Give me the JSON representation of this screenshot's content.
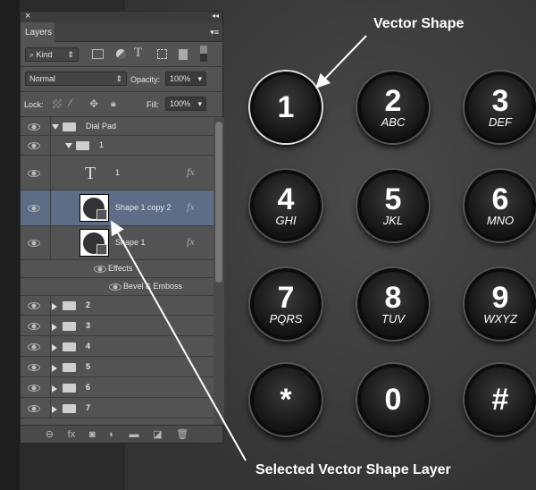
{
  "panel": {
    "close": "×",
    "collapse": "◂◂",
    "tab": "Layers",
    "menu": "▾≡",
    "filter": "Kind",
    "blend_mode": "Normal",
    "opacity_label": "Opacity:",
    "opacity": "100%",
    "lock_label": "Lock:",
    "fill_label": "Fill:",
    "fill": "100%"
  },
  "layers": [
    {
      "name": "Dial Pad",
      "type": "group",
      "expanded": true
    },
    {
      "name": "1",
      "type": "group",
      "expanded": true
    },
    {
      "name": "1",
      "type": "text",
      "fx": "fx"
    },
    {
      "name": "Shape 1 copy 2",
      "type": "shape",
      "fx": "fx",
      "selected": true
    },
    {
      "name": "Shape 1",
      "type": "shape",
      "fx": "fx"
    },
    {
      "name": "Effects",
      "type": "effects"
    },
    {
      "name": "Bevel & Emboss",
      "type": "effect"
    },
    {
      "name": "2",
      "type": "group"
    },
    {
      "name": "3",
      "type": "group"
    },
    {
      "name": "4",
      "type": "group"
    },
    {
      "name": "5",
      "type": "group"
    },
    {
      "name": "6",
      "type": "group"
    },
    {
      "name": "7",
      "type": "group"
    }
  ],
  "footer_icons": [
    "link-icon",
    "fx-icon",
    "mask-icon",
    "adjustment-icon",
    "folder-icon",
    "new-layer-icon",
    "trash-icon"
  ],
  "keypad": [
    {
      "d": "1",
      "l": ""
    },
    {
      "d": "2",
      "l": "ABC"
    },
    {
      "d": "3",
      "l": "DEF"
    },
    {
      "d": "4",
      "l": "GHI"
    },
    {
      "d": "5",
      "l": "JKL"
    },
    {
      "d": "6",
      "l": "MNO"
    },
    {
      "d": "7",
      "l": "PQRS"
    },
    {
      "d": "8",
      "l": "TUV"
    },
    {
      "d": "9",
      "l": "WXYZ"
    },
    {
      "d": "*",
      "l": ""
    },
    {
      "d": "0",
      "l": ""
    },
    {
      "d": "#",
      "l": ""
    }
  ],
  "annotations": {
    "top": "Vector Shape",
    "bottom": "Selected Vector Shape Layer"
  },
  "colors": {
    "selected_row": "#5d6d86",
    "panel": "#535353"
  }
}
